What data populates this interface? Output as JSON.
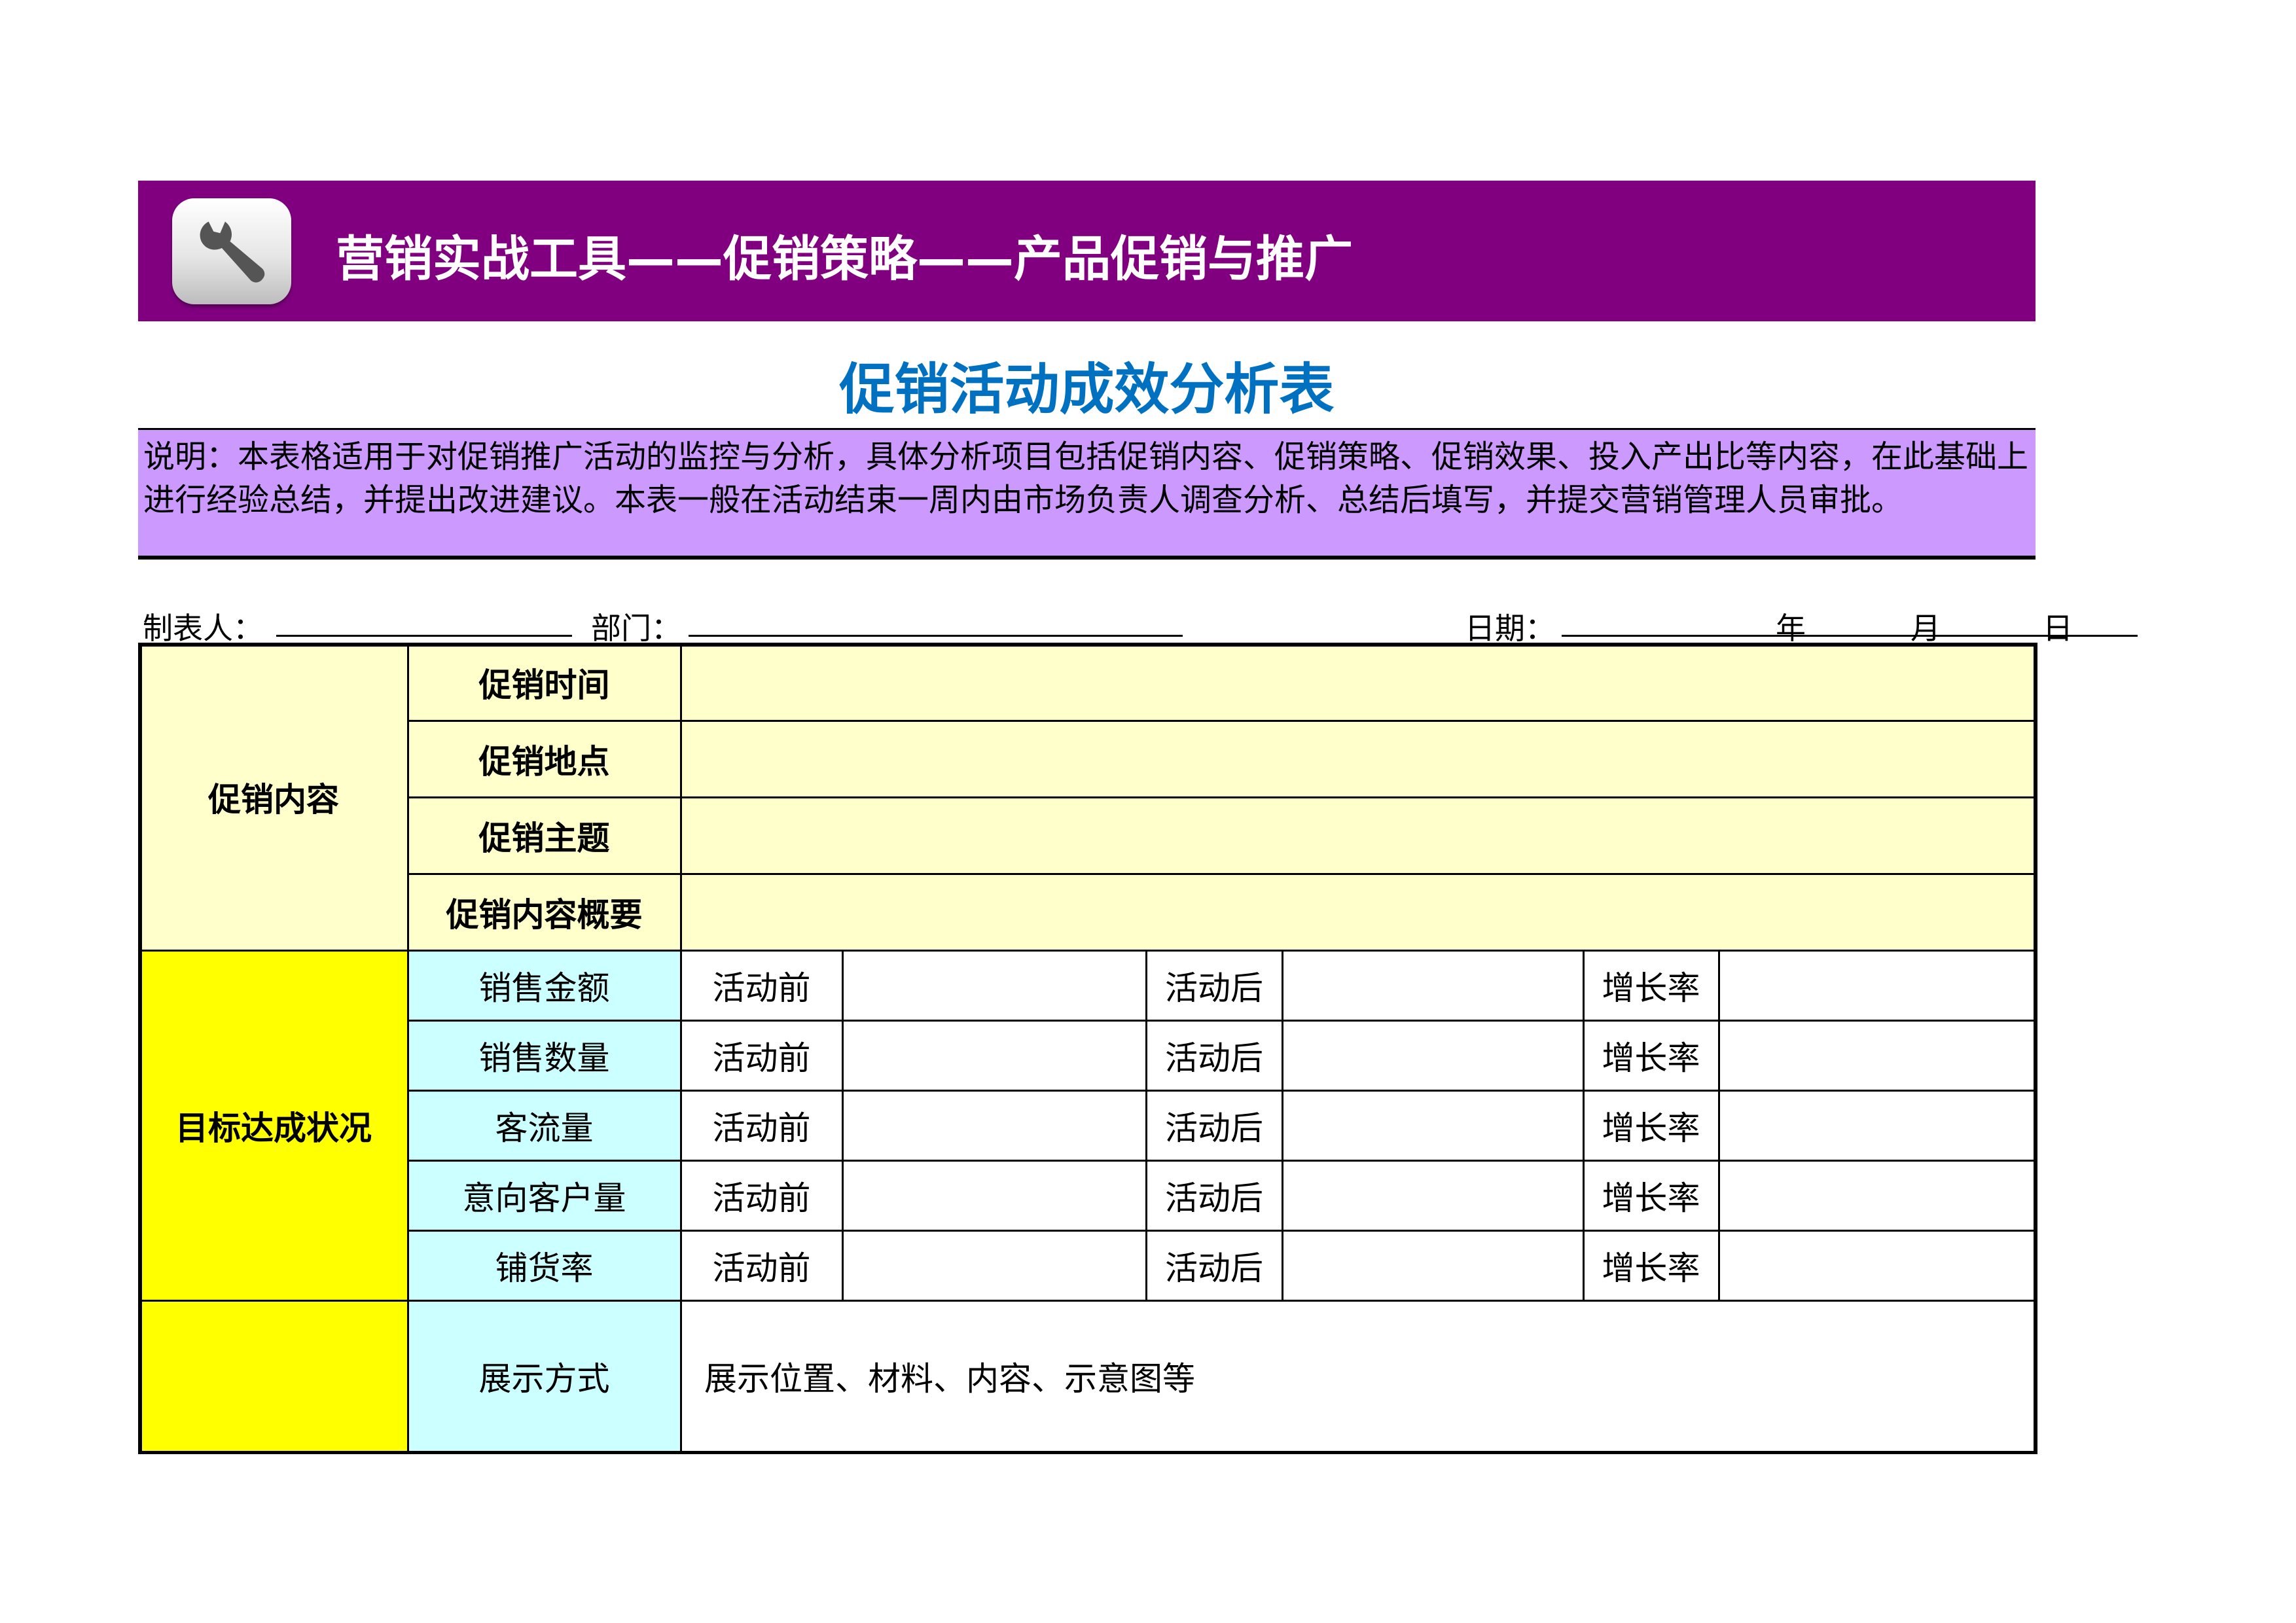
{
  "header": {
    "banner_title": "营销实战工具——促销策略——产品促销与推广",
    "banner_icon": "wrench-icon",
    "banner_color": "#800080"
  },
  "sheet": {
    "title": "促销活动成效分析表",
    "title_color": "#0070c0",
    "description": "说明：本表格适用于对促销推广活动的监控与分析，具体分析项目包括促销内容、促销策略、促销效果、投入产出比等内容，在此基础上进行经验总结，并提出改进建议。本表一般在活动结束一周内由市场负责人调查分析、总结后填写，并提交营销管理人员审批。",
    "description_bg": "#cc99ff"
  },
  "meta": {
    "preparer_label": "制表人：",
    "department_label": "部门：",
    "date_label": "日期：",
    "year_label": "年",
    "month_label": "月",
    "day_label": "日"
  },
  "content_section": {
    "label": "促销内容",
    "bg": "#ffffcc",
    "rows": [
      {
        "label": "促销时间",
        "value": ""
      },
      {
        "label": "促销地点",
        "value": ""
      },
      {
        "label": "促销主题",
        "value": ""
      },
      {
        "label": "促销内容概要",
        "value": ""
      }
    ]
  },
  "target_section": {
    "label": "目标达成状况",
    "bg": "#ffff00",
    "metric_bg": "#ccffff",
    "before_label": "活动前",
    "after_label": "活动后",
    "growth_label": "增长率",
    "rows": [
      {
        "metric": "销售金额",
        "before": "",
        "after": "",
        "growth": ""
      },
      {
        "metric": "销售数量",
        "before": "",
        "after": "",
        "growth": ""
      },
      {
        "metric": "客流量",
        "before": "",
        "after": "",
        "growth": ""
      },
      {
        "metric": "意向客户量",
        "before": "",
        "after": "",
        "growth": ""
      },
      {
        "metric": "铺货率",
        "before": "",
        "after": "",
        "growth": ""
      }
    ]
  },
  "display_section": {
    "label": "",
    "metric": "展示方式",
    "value": "展示位置、材料、内容、示意图等"
  }
}
